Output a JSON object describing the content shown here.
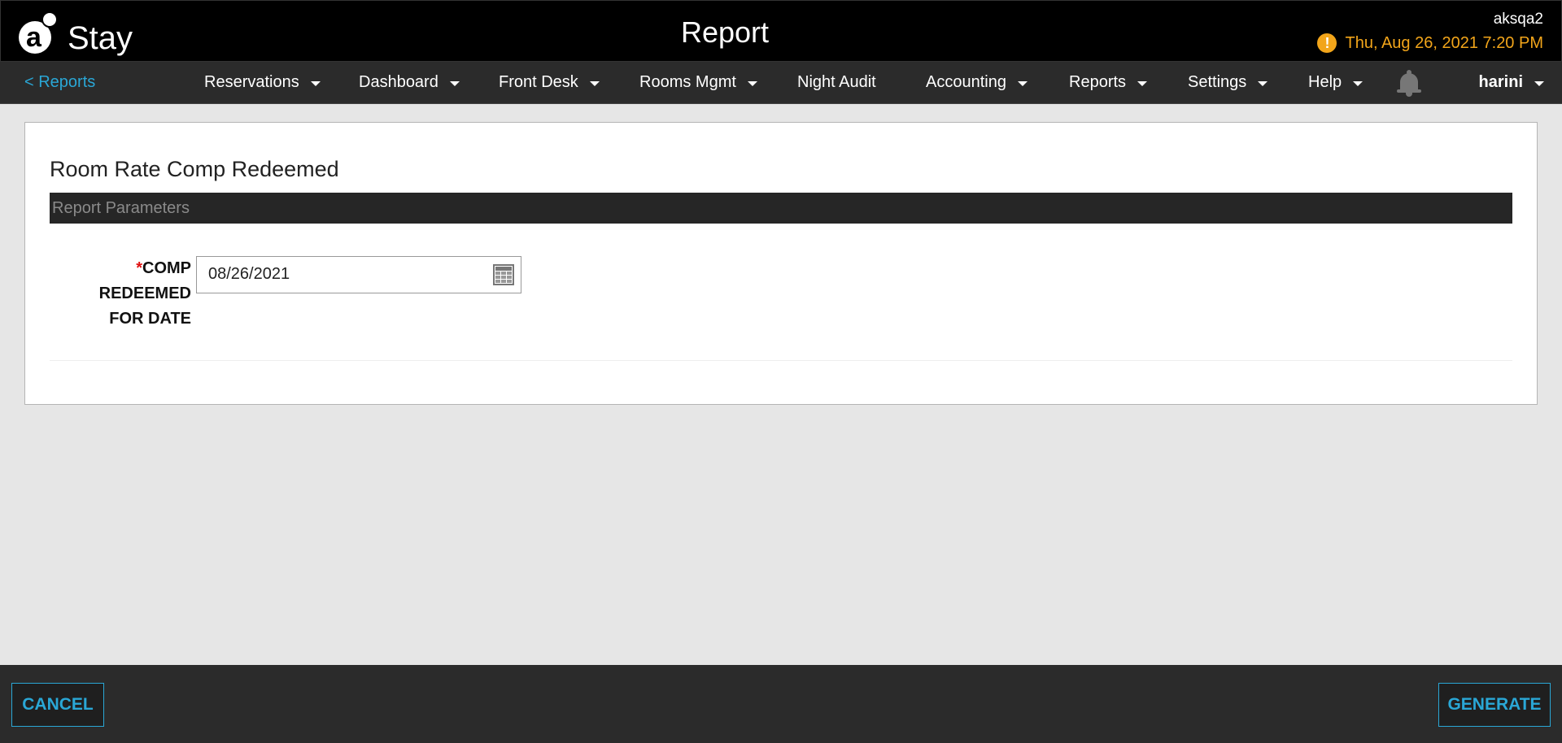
{
  "app": {
    "logo_text": "Stay",
    "logo_mark": "a",
    "page_title": "Report"
  },
  "user": {
    "account": "aksqa2",
    "datetime": "Thu, Aug 26, 2021 7:20 PM",
    "username": "harini",
    "warning_icon": "!"
  },
  "nav": {
    "back_label": "< Reports",
    "items": [
      {
        "label": "Reservations",
        "has_menu": true
      },
      {
        "label": "Dashboard",
        "has_menu": true
      },
      {
        "label": "Front Desk",
        "has_menu": true
      },
      {
        "label": "Rooms Mgmt",
        "has_menu": true
      },
      {
        "label": "Night Audit",
        "has_menu": false
      },
      {
        "label": "Accounting",
        "has_menu": true
      },
      {
        "label": "Reports",
        "has_menu": true
      },
      {
        "label": "Settings",
        "has_menu": true
      },
      {
        "label": "Help",
        "has_menu": true
      }
    ],
    "notification_icon": "bell-icon"
  },
  "report": {
    "title": "Room Rate Comp Redeemed",
    "params_header": "Report Parameters",
    "field": {
      "required_mark": "*",
      "label": "COMP REDEEMED FOR DATE",
      "value": "08/26/2021",
      "icon": "calendar-icon"
    }
  },
  "footer": {
    "cancel_label": "CANCEL",
    "generate_label": "GENERATE"
  },
  "colors": {
    "accent": "#2aa7d6",
    "warning": "#f2a51a",
    "header_bg": "#000000",
    "nav_bg": "#2b2b2b",
    "required": "#e01010"
  }
}
